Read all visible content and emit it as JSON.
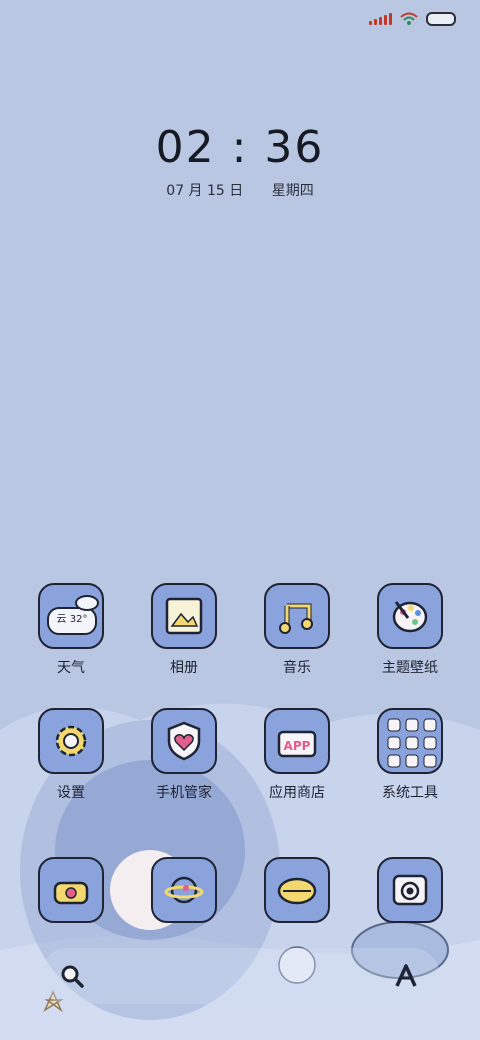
{
  "status_bar": {
    "battery_icon": "battery-icon",
    "wifi_icon": "wifi-icon",
    "signal_icon": "signal-icon"
  },
  "clock": {
    "time": "02 : 36",
    "date": "07 月 15 日",
    "weekday": "星期四"
  },
  "apps": [
    {
      "label": "天气",
      "icon": "weather-icon",
      "widget_text": "云 32°"
    },
    {
      "label": "相册",
      "icon": "gallery-icon"
    },
    {
      "label": "音乐",
      "icon": "music-icon"
    },
    {
      "label": "主题壁纸",
      "icon": "palette-icon"
    },
    {
      "label": "设置",
      "icon": "gear-icon"
    },
    {
      "label": "手机管家",
      "icon": "shield-icon"
    },
    {
      "label": "应用商店",
      "icon": "app-store-icon"
    },
    {
      "label": "系统工具",
      "icon": "folder-icon"
    }
  ],
  "dock": {
    "left_icon": "search-icon",
    "right_icon": "a-letter-icon"
  },
  "colors": {
    "background": "#bac7e2",
    "tile": "#8ba3dc",
    "outline": "#1e2433",
    "accent": "#f2d86e"
  }
}
